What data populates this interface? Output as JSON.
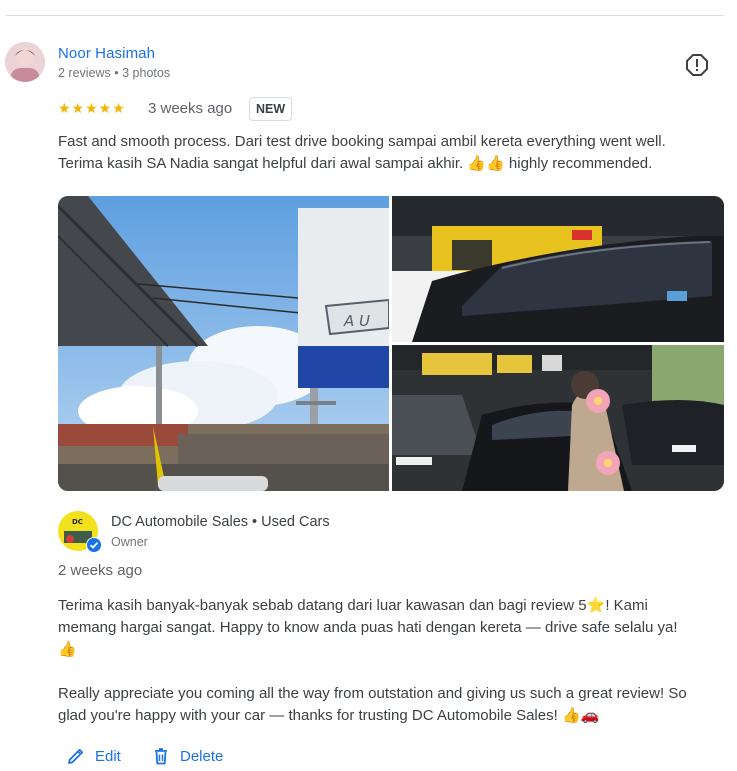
{
  "review": {
    "reviewer_name": "Noor Hasimah",
    "reviewer_meta": "2 reviews • 3 photos",
    "rating_stars": "★★★★★",
    "rating": 5,
    "time": "3 weeks ago",
    "badge": "NEW",
    "text_lines": [
      "Fast and smooth process. Dari test drive booking sampai ambil kereta everything went well.",
      "Terima kasih SA Nadia sangat helpful dari awal sampai akhir. 👍👍 highly recommended."
    ],
    "photos": [
      {
        "name": "photo-dealership-sign"
      },
      {
        "name": "photo-car-showroom"
      },
      {
        "name": "photo-customer-with-car"
      }
    ],
    "sign_text": "A U"
  },
  "reply": {
    "owner_name": "DC Automobile Sales • Used Cars",
    "owner_role": "Owner",
    "time": "2 weeks ago",
    "lines_malay": [
      "Terima kasih banyak-banyak sebab datang dari luar kawasan dan bagi review 5⭐! Kami",
      "memang hargai sangat. Happy to know anda puas hati dengan kereta — drive safe selalu ya!",
      "👍"
    ],
    "lines_english": [
      "Really appreciate you coming all the way from outstation and giving us such a great review! So",
      "glad you're happy with your car — thanks for trusting DC Automobile Sales! 👍🚗"
    ]
  },
  "actions": {
    "edit_label": "Edit",
    "delete_label": "Delete"
  },
  "icons": {
    "report": "report-flag-icon",
    "edit": "pencil-icon",
    "delete": "trash-icon",
    "verified": "verified-check-icon"
  },
  "colors": {
    "link_blue": "#1a73e8",
    "star_gold": "#f4b400",
    "text": "#3c4043",
    "secondary_text": "#70757a"
  }
}
